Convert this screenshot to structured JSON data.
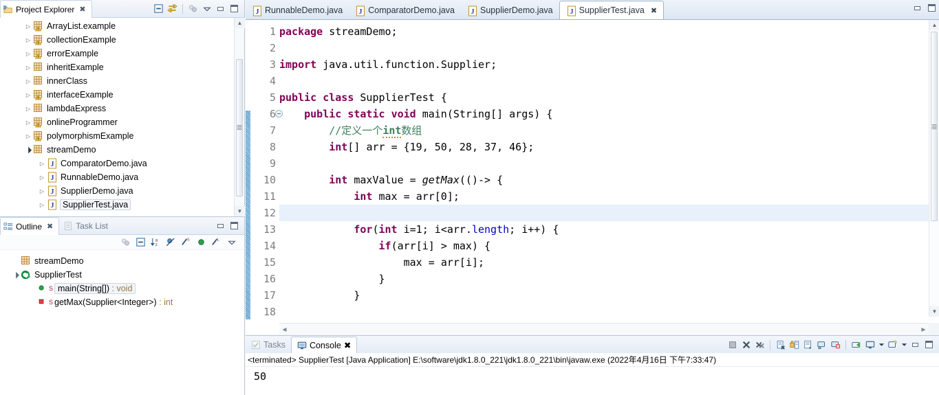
{
  "project_explorer": {
    "title": "Project Explorer",
    "icon": "project-explorer-icon",
    "tools": [
      "collapse-all-icon",
      "link-with-editor-icon",
      "view-menu-icon",
      "minimize-icon",
      "maximize-icon"
    ],
    "tree": [
      {
        "label": "ArrayList.example",
        "indent": 1,
        "expander": "collapsed",
        "icon": "java-project-warning-icon"
      },
      {
        "label": "collectionExample",
        "indent": 1,
        "expander": "collapsed",
        "icon": "java-project-warning-icon"
      },
      {
        "label": "errorExample",
        "indent": 1,
        "expander": "collapsed",
        "icon": "java-project-warning-icon"
      },
      {
        "label": "inheritExample",
        "indent": 1,
        "expander": "collapsed",
        "icon": "java-project-icon"
      },
      {
        "label": "innerClass",
        "indent": 1,
        "expander": "collapsed",
        "icon": "java-project-icon"
      },
      {
        "label": "interfaceExample",
        "indent": 1,
        "expander": "collapsed",
        "icon": "java-project-warning-icon"
      },
      {
        "label": "lambdaExpress",
        "indent": 1,
        "expander": "collapsed",
        "icon": "java-project-icon"
      },
      {
        "label": "onlineProgrammer",
        "indent": 1,
        "expander": "collapsed",
        "icon": "java-project-warning-icon"
      },
      {
        "label": "polymorphismExample",
        "indent": 1,
        "expander": "collapsed",
        "icon": "java-project-warning-icon"
      },
      {
        "label": "streamDemo",
        "indent": 1,
        "expander": "expanded",
        "icon": "java-project-icon"
      },
      {
        "label": "ComparatorDemo.java",
        "indent": 2,
        "expander": "collapsed",
        "icon": "java-file-icon"
      },
      {
        "label": "RunnableDemo.java",
        "indent": 2,
        "expander": "collapsed",
        "icon": "java-file-icon"
      },
      {
        "label": "SupplierDemo.java",
        "indent": 2,
        "expander": "collapsed",
        "icon": "java-file-icon"
      },
      {
        "label": "SupplierTest.java",
        "indent": 2,
        "expander": "collapsed",
        "icon": "java-file-icon",
        "selected": true
      }
    ]
  },
  "outline": {
    "tabs": [
      {
        "label": "Outline",
        "icon": "outline-icon",
        "active": true,
        "closeable": true
      },
      {
        "label": "Task List",
        "icon": "task-list-icon",
        "active": false,
        "closeable": false
      }
    ],
    "tools": [
      "focus-on-active-task-icon",
      "collapse-all-icon",
      "sort-icon",
      "hide-fields-icon",
      "hide-static-icon",
      "hide-non-public-icon",
      "hide-local-types-icon",
      "view-menu-icon"
    ],
    "win_tools": [
      "minimize-icon",
      "maximize-icon"
    ],
    "items": [
      {
        "label": "streamDemo",
        "indent": 1,
        "expander": "none",
        "icon": "package-icon",
        "badge": ""
      },
      {
        "label": "SupplierTest",
        "indent": 1,
        "expander": "expanded",
        "icon": "class-icon",
        "badge": ""
      },
      {
        "label": "main(String[])",
        "suffix": " : void",
        "indent": 2,
        "expander": "none",
        "icon": "public-method-icon",
        "badge": "S",
        "selected": true
      },
      {
        "label": "getMax(Supplier<Integer>)",
        "suffix": " : int",
        "indent": 2,
        "expander": "none",
        "icon": "private-method-icon",
        "badge": "S"
      }
    ]
  },
  "editor": {
    "tabs": [
      {
        "label": "RunnableDemo.java",
        "icon": "java-file-icon",
        "active": false
      },
      {
        "label": "ComparatorDemo.java",
        "icon": "java-file-icon",
        "active": false
      },
      {
        "label": "SupplierDemo.java",
        "icon": "java-file-icon",
        "active": false
      },
      {
        "label": "SupplierTest.java",
        "icon": "java-file-icon",
        "active": true,
        "closeable": true
      }
    ],
    "win_tools": [
      "minimize-icon",
      "maximize-icon"
    ],
    "highlight_line": 12,
    "folding_line": 6,
    "lines": [
      {
        "n": 1,
        "text": "package streamDemo;"
      },
      {
        "n": 2,
        "text": ""
      },
      {
        "n": 3,
        "text": "import java.util.function.Supplier;"
      },
      {
        "n": 4,
        "text": ""
      },
      {
        "n": 5,
        "text": "public class SupplierTest {"
      },
      {
        "n": 6,
        "text": "    public static void main(String[] args) {"
      },
      {
        "n": 7,
        "text": "        //定义一个int数组"
      },
      {
        "n": 8,
        "text": "        int[] arr = {19, 50, 28, 37, 46};"
      },
      {
        "n": 9,
        "text": ""
      },
      {
        "n": 10,
        "text": "        int maxValue = getMax(()-> {"
      },
      {
        "n": 11,
        "text": "            int max = arr[0];"
      },
      {
        "n": 12,
        "text": ""
      },
      {
        "n": 13,
        "text": "            for(int i=1; i<arr.length; i++) {"
      },
      {
        "n": 14,
        "text": "                if(arr[i] > max) {"
      },
      {
        "n": 15,
        "text": "                    max = arr[i];"
      },
      {
        "n": 16,
        "text": "                }"
      },
      {
        "n": 17,
        "text": "            }"
      },
      {
        "n": 18,
        "text": ""
      }
    ]
  },
  "console": {
    "tabs": [
      {
        "label": "Tasks",
        "icon": "tasks-icon",
        "active": false,
        "closeable": false
      },
      {
        "label": "Console",
        "icon": "console-icon",
        "active": true,
        "closeable": true
      }
    ],
    "tools": [
      "terminate-icon",
      "remove-launch-icon",
      "remove-all-terminated-icon",
      "clear-console-icon",
      "scroll-lock-icon",
      "word-wrap-icon",
      "pin-console-icon",
      "display-selected-console-icon",
      "open-console-icon",
      "display-selected-console-dropdown-icon",
      "new-console-view-icon",
      "new-console-dropdown-icon",
      "minimize-icon",
      "maximize-icon"
    ],
    "status": "<terminated> SupplierTest [Java Application] E:\\software\\jdk1.8.0_221\\jdk1.8.0_221\\bin\\javaw.exe (2022年4月16日 下午7:33:47)",
    "output": "50"
  },
  "colors": {
    "keyword": "#7F0055",
    "comment": "#3F7F5F",
    "field": "#0000C0",
    "plain": "#000000",
    "selection": "#E8F0FB",
    "chrome": "#DDE7F4",
    "border": "#B9C7D8"
  }
}
